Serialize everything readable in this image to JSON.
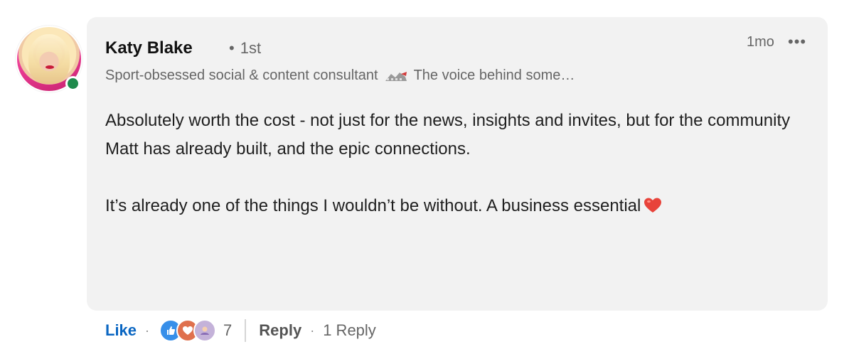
{
  "comment": {
    "author_name": "Katy Blake",
    "connection_degree": "1st",
    "connection_separator": "•",
    "timestamp": "1mo",
    "more_menu": "•••",
    "headline": "Sport-obsessed social & content consultant",
    "headline_suffix": "The voice behind some…",
    "body_paragraph_1": "Absolutely worth the cost - not just for the news, insights and invites, but for the community Matt has already built, and the epic connections.",
    "body_paragraph_2": "It’s already one of the things I wouldn’t be without. A business essential"
  },
  "actions": {
    "like_label": "Like",
    "separator": "·",
    "reaction_count": "7",
    "reply_label": "Reply",
    "reply_count_label": "1 Reply"
  },
  "colors": {
    "bubble_bg": "#f2f2f2",
    "like_blue": "#0a66c2",
    "online_green": "#1f8a4c",
    "secondary_text": "#666666"
  },
  "icons": [
    "online-status-icon",
    "racing-flag-icon",
    "heart-emoji-icon",
    "like-reaction-icon",
    "love-reaction-icon",
    "support-reaction-icon",
    "more-icon"
  ]
}
